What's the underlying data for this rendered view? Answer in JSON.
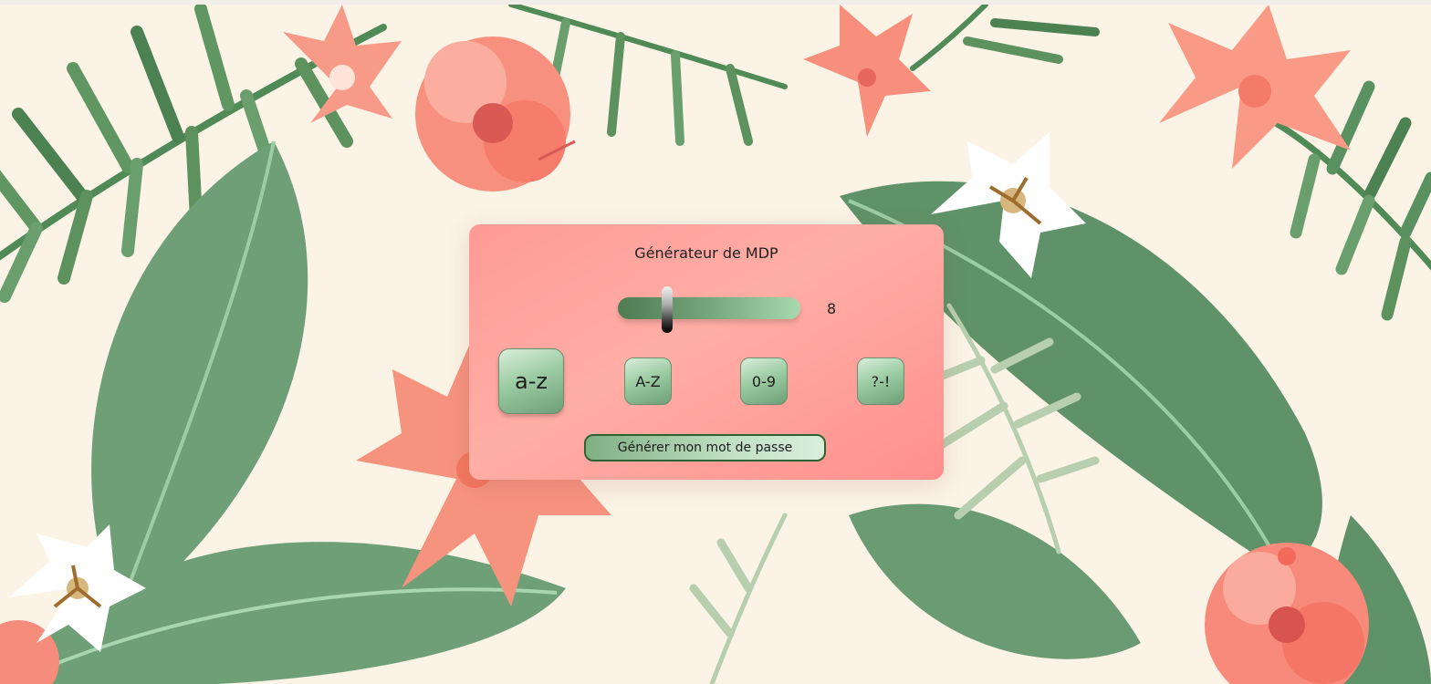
{
  "generator": {
    "title": "Générateur de MDP",
    "length_value": "8",
    "length_slider": {
      "value": 8
    },
    "options": {
      "lowercase_label": "a-z",
      "uppercase_label": "A-Z",
      "digits_label": "0-9",
      "symbols_label": "?-!"
    },
    "generate_label": "Générer mon mot de passe"
  },
  "colors": {
    "background": "#fbf3e5",
    "panel": "#ff9a95",
    "leaf_green": "#6f9f77",
    "flower_coral": "#f7887a",
    "button_border": "#2f6231"
  }
}
